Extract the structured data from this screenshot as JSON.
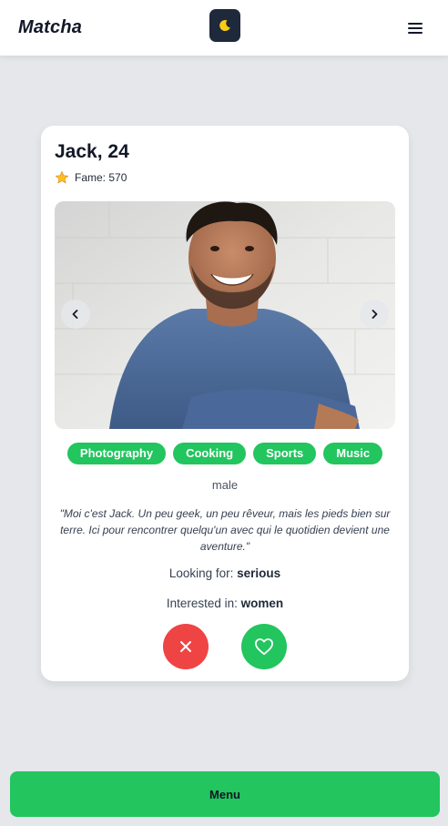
{
  "app": {
    "logo": "Matcha"
  },
  "header": {
    "theme_icon": "moon-icon",
    "menu_icon": "hamburger-icon"
  },
  "profile": {
    "name_age": "Jack, 24",
    "fame_label": "Fame: 570",
    "photo_alt": "profile-photo",
    "tags": [
      "Photography",
      "Cooking",
      "Sports",
      "Music"
    ],
    "gender": "male",
    "bio": "\"Moi c'est Jack. Un peu geek, un peu rêveur, mais les pieds bien sur terre. Ici pour rencontrer quelqu'un avec qui le quotidien devient une aventure.\"",
    "looking_for_label": "Looking for:",
    "looking_for_value": "serious",
    "interested_in_label": "Interested in:",
    "interested_in_value": "women"
  },
  "actions": {
    "reject_icon": "close-icon",
    "like_icon": "heart-icon"
  },
  "footer": {
    "menu_label": "Menu"
  },
  "colors": {
    "accent": "#22c55e",
    "reject": "#ef4444",
    "background": "#e5e7eb",
    "toggle_bg": "#1e293b",
    "star": "#fbbf24"
  }
}
